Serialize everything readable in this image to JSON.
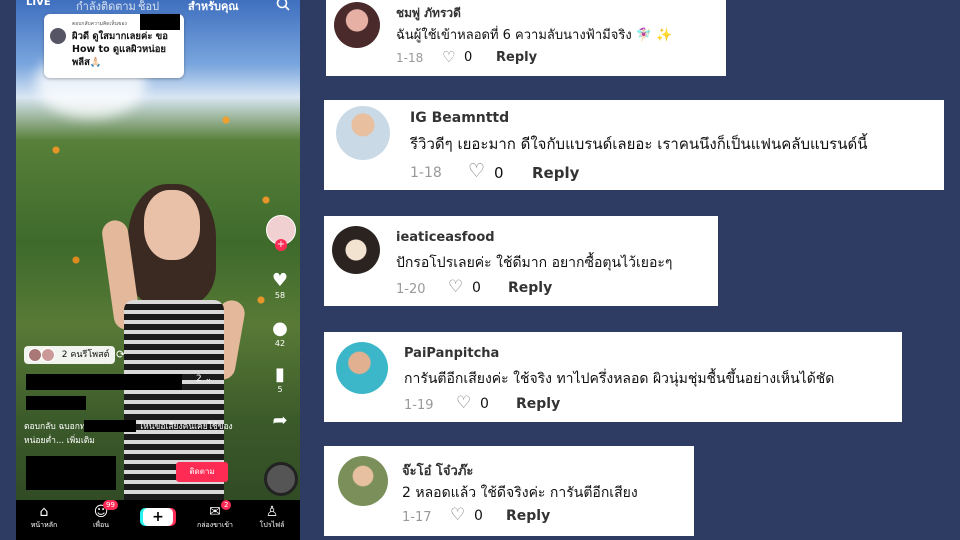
{
  "phone": {
    "top_tabs": {
      "live": "LIVE",
      "following": "กำลังติดตาม",
      "shop": "ช็อป",
      "for_you": "สำหรับคุณ"
    },
    "reply_card": {
      "header": "ตอบกลับความคิดเห็นของ",
      "text": "ผิวดี ดูใสมากเลยค่ะ ขอ How to ดูแลผิวหน่อยพลีส🙏🏻"
    },
    "side": {
      "likes": "58",
      "comments": "42",
      "saves": "5"
    },
    "friends_label": "2 คนรีโพสต์",
    "dropdown_value": "2",
    "caption": "ตอบกลับ                 ฉบอกทริคแล้วน้าาาา ไหนขอเสียงคนเคยใช้ของหน่อยค่ำ... เพิ่มเติม",
    "follow_label": "ติดตาม",
    "nav": [
      {
        "label": "หน้าหลัก",
        "icon": "home-icon"
      },
      {
        "label": "เพื่อน",
        "icon": "friends-icon",
        "badge": "99"
      },
      {
        "label": "",
        "icon": "create-icon"
      },
      {
        "label": "กล่องขาเข้า",
        "icon": "inbox-icon",
        "badge": "2"
      },
      {
        "label": "โปรไฟล์",
        "icon": "profile-icon"
      }
    ]
  },
  "comments": [
    {
      "user": "ชมพู่ ภัทรวดี",
      "text": "ฉันผู้ใช้เข้าหลอดที่ 6 ความลับนางฟ้ามีจริง 🧚🏻‍♀️ ✨",
      "date": "1-18",
      "likes": "0",
      "reply": "Reply"
    },
    {
      "user": "IG Beamnttd",
      "text": "รีวิวดีๆ เยอะมาก ดีใจกับแบรนด์เลยอะ เราคนนึงก็เป็นแฟนคลับแบรนด์นี้",
      "date": "1-18",
      "likes": "0",
      "reply": "Reply"
    },
    {
      "user": "ieaticeasfood",
      "text": "ปักรอโปรเลยค่ะ ใช้ดีมาก อยากซื้อตุนไว้เยอะๆ",
      "date": "1-20",
      "likes": "0",
      "reply": "Reply"
    },
    {
      "user": "PaiPanpitcha",
      "text": "การันตีอีกเสียงค่ะ ใช้จริง ทาไปครึ่งหลอด ผิวนุ่มชุ่มชื้นขึ้นอย่างเห็นได้ชัด",
      "date": "1-19",
      "likes": "0",
      "reply": "Reply"
    },
    {
      "user": "จ๊ะโอ๋ โจ๋วภ๊ะ",
      "text": "2 หลอดแล้ว ใช้ดีจริงค่ะ การันตีอีกเสียง",
      "date": "1-17",
      "likes": "0",
      "reply": "Reply"
    }
  ]
}
